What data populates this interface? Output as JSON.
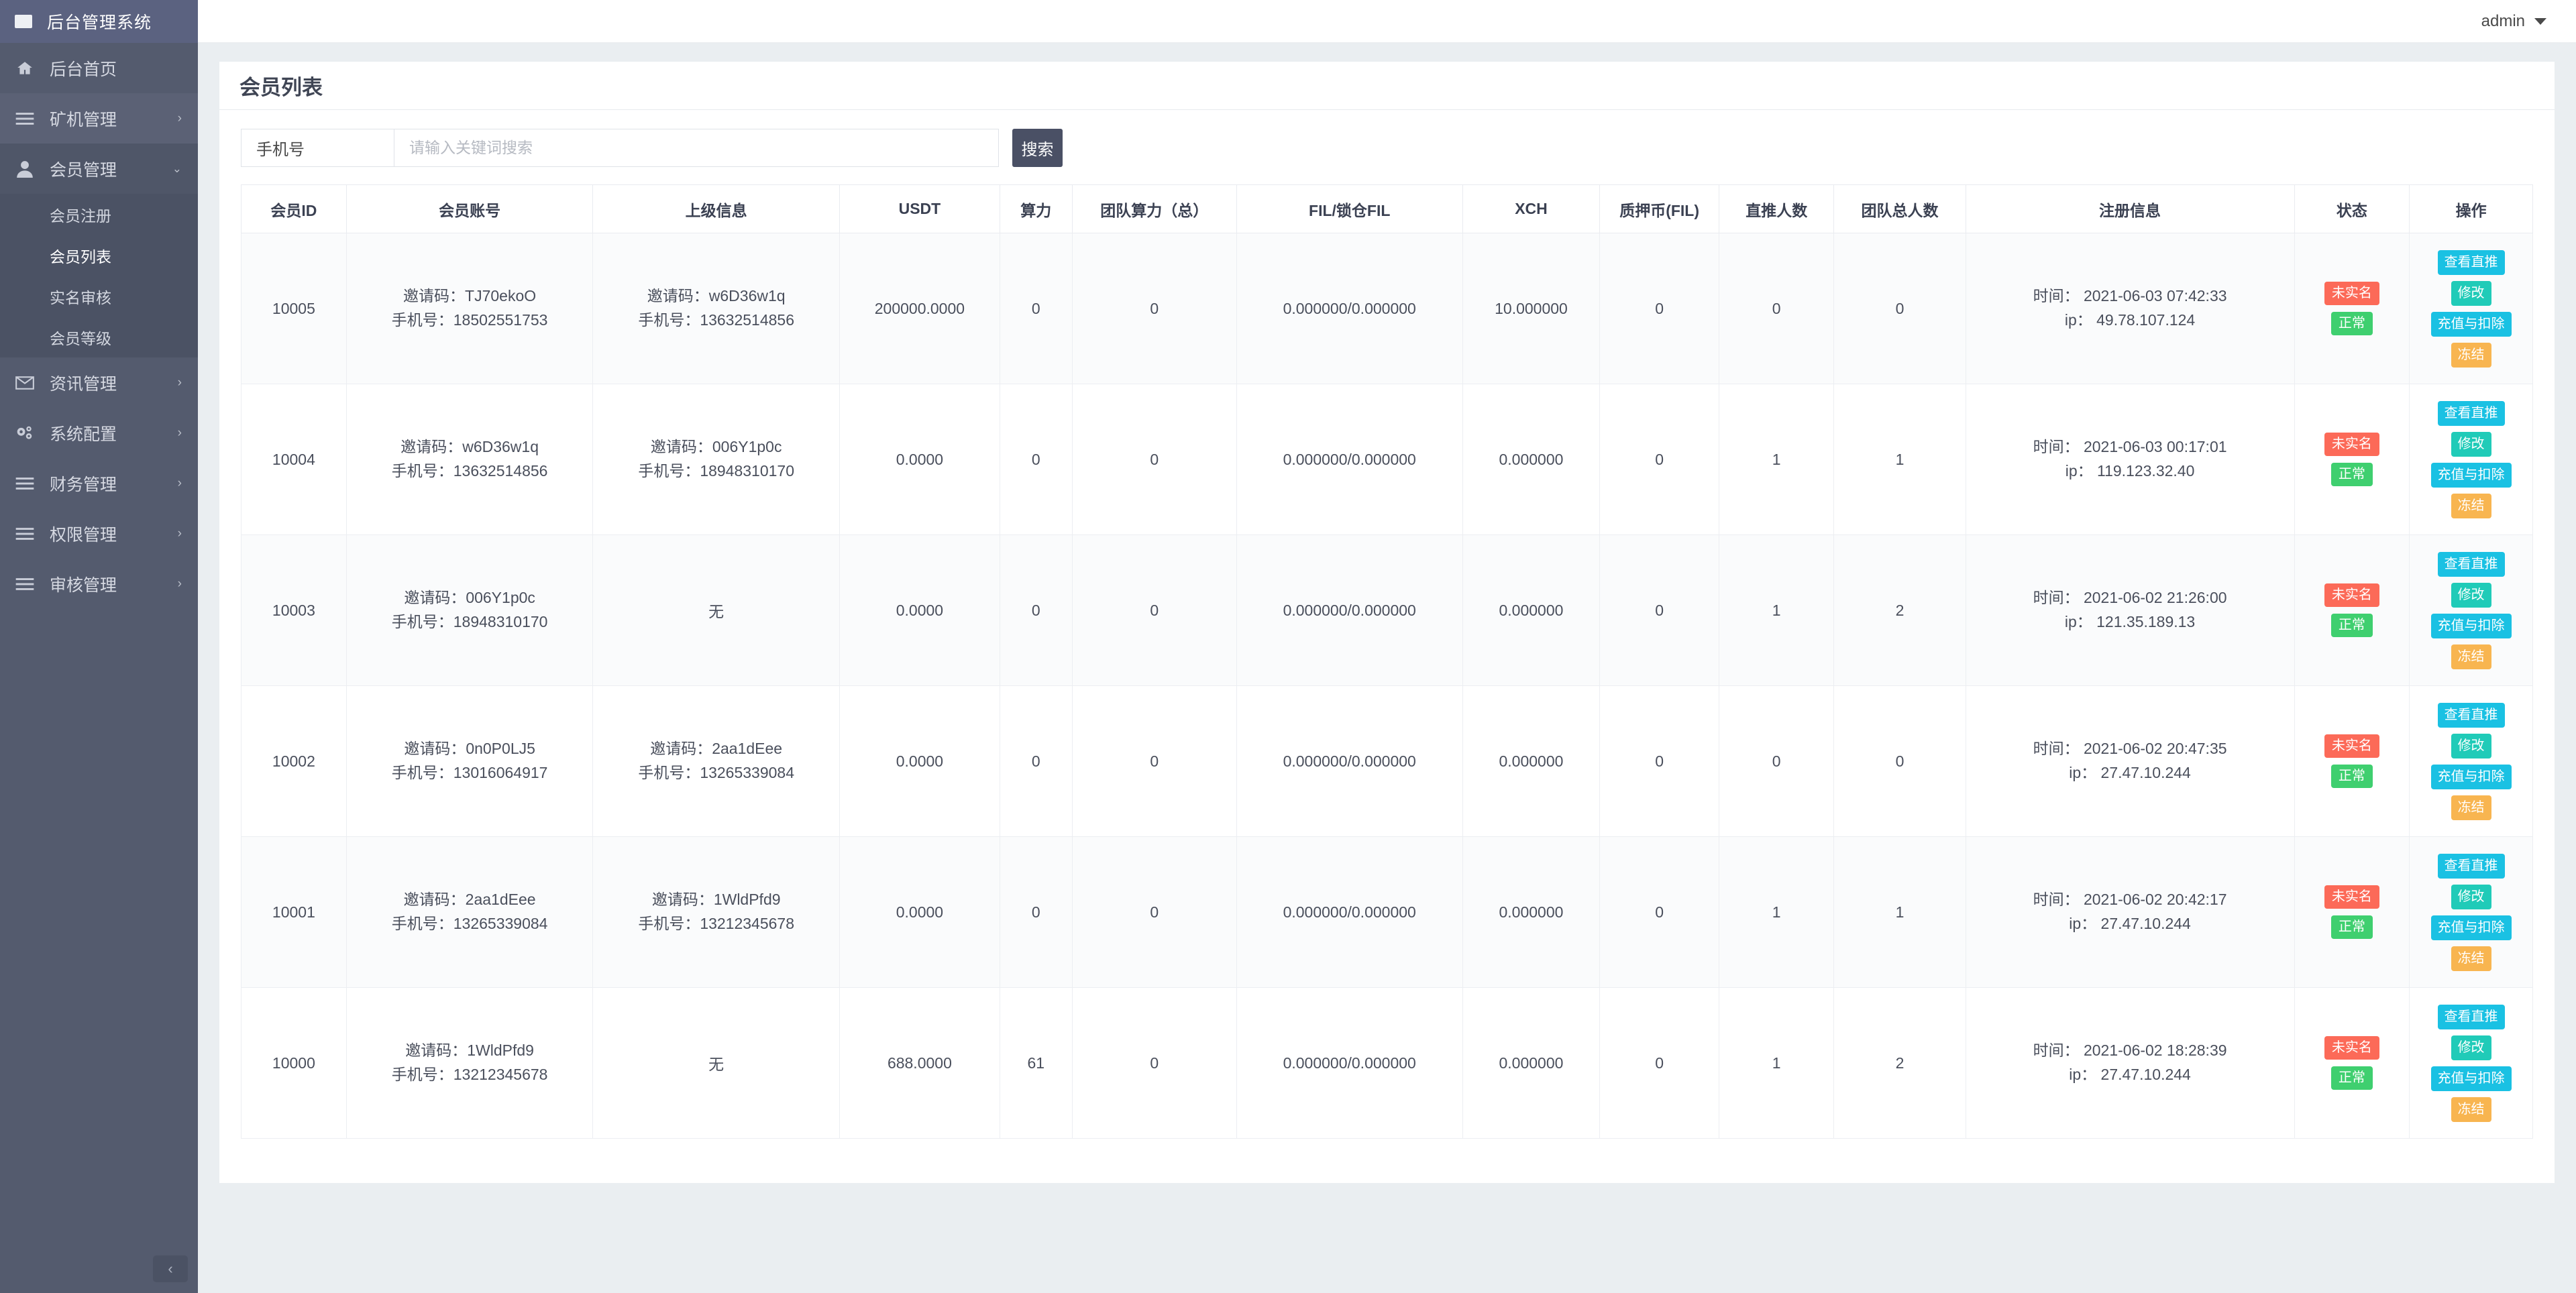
{
  "app": {
    "title": "后台管理系统",
    "logo_icon": "square-logo-icon"
  },
  "sidebar": {
    "items": [
      {
        "label": "后台首页",
        "icon": "home-icon",
        "arrow": "",
        "state": "plain"
      },
      {
        "label": "矿机管理",
        "icon": "list-icon",
        "arrow": "›",
        "state": "alt"
      },
      {
        "label": "会员管理",
        "icon": "user-icon",
        "arrow": "⌄",
        "state": "open"
      },
      {
        "label": "资讯管理",
        "icon": "envelope-icon",
        "arrow": "›",
        "state": "plain"
      },
      {
        "label": "系统配置",
        "icon": "gears-icon",
        "arrow": "›",
        "state": "plain"
      },
      {
        "label": "财务管理",
        "icon": "list-icon",
        "arrow": "›",
        "state": "plain"
      },
      {
        "label": "权限管理",
        "icon": "list-icon",
        "arrow": "›",
        "state": "plain"
      },
      {
        "label": "审核管理",
        "icon": "list-icon",
        "arrow": "›",
        "state": "plain"
      }
    ],
    "submenu": [
      {
        "label": "会员注册",
        "active": false
      },
      {
        "label": "会员列表",
        "active": true
      },
      {
        "label": "实名审核",
        "active": false
      },
      {
        "label": "会员等级",
        "active": false
      }
    ],
    "collapse_icon": "chevron-left-icon"
  },
  "topbar": {
    "admin_label": "admin",
    "caret_icon": "caret-down-icon"
  },
  "page": {
    "title": "会员列表"
  },
  "search": {
    "field_label": "手机号",
    "placeholder": "请输入关键词搜索",
    "value": "",
    "button_label": "搜索"
  },
  "table": {
    "headers": [
      "会员ID",
      "会员账号",
      "上级信息",
      "USDT",
      "算力",
      "团队算力（总）",
      "FIL/锁仓FIL",
      "XCH",
      "质押币(FIL)",
      "直推人数",
      "团队总人数",
      "注册信息",
      "状态",
      "操作"
    ],
    "labels": {
      "invite_code": "邀请码：",
      "phone": "手机号：",
      "time": "时间：",
      "ip": "ip：",
      "none": "无"
    },
    "rows": [
      {
        "id": "10005",
        "account_code": "TJ70ekoO",
        "account_phone": "18502551753",
        "parent_code": "w6D36w1q",
        "parent_phone": "13632514856",
        "parent_none": false,
        "usdt": "200000.0000",
        "power": "0",
        "team_power": "0",
        "fil": "0.000000/0.000000",
        "xch": "10.000000",
        "pledge": "0",
        "direct": "0",
        "team_total": "0",
        "reg_time": "2021-06-03 07:42:33",
        "reg_ip": "49.78.107.124"
      },
      {
        "id": "10004",
        "account_code": "w6D36w1q",
        "account_phone": "13632514856",
        "parent_code": "006Y1p0c",
        "parent_phone": "18948310170",
        "parent_none": false,
        "usdt": "0.0000",
        "power": "0",
        "team_power": "0",
        "fil": "0.000000/0.000000",
        "xch": "0.000000",
        "pledge": "0",
        "direct": "1",
        "team_total": "1",
        "reg_time": "2021-06-03 00:17:01",
        "reg_ip": "119.123.32.40"
      },
      {
        "id": "10003",
        "account_code": "006Y1p0c",
        "account_phone": "18948310170",
        "parent_code": "",
        "parent_phone": "",
        "parent_none": true,
        "usdt": "0.0000",
        "power": "0",
        "team_power": "0",
        "fil": "0.000000/0.000000",
        "xch": "0.000000",
        "pledge": "0",
        "direct": "1",
        "team_total": "2",
        "reg_time": "2021-06-02 21:26:00",
        "reg_ip": "121.35.189.13"
      },
      {
        "id": "10002",
        "account_code": "0n0P0LJ5",
        "account_phone": "13016064917",
        "parent_code": "2aa1dEee",
        "parent_phone": "13265339084",
        "parent_none": false,
        "usdt": "0.0000",
        "power": "0",
        "team_power": "0",
        "fil": "0.000000/0.000000",
        "xch": "0.000000",
        "pledge": "0",
        "direct": "0",
        "team_total": "0",
        "reg_time": "2021-06-02 20:47:35",
        "reg_ip": "27.47.10.244"
      },
      {
        "id": "10001",
        "account_code": "2aa1dEee",
        "account_phone": "13265339084",
        "parent_code": "1WldPfd9",
        "parent_phone": "13212345678",
        "parent_none": false,
        "usdt": "0.0000",
        "power": "0",
        "team_power": "0",
        "fil": "0.000000/0.000000",
        "xch": "0.000000",
        "pledge": "0",
        "direct": "1",
        "team_total": "1",
        "reg_time": "2021-06-02 20:42:17",
        "reg_ip": "27.47.10.244"
      },
      {
        "id": "10000",
        "account_code": "1WldPfd9",
        "account_phone": "13212345678",
        "parent_code": "",
        "parent_phone": "",
        "parent_none": true,
        "usdt": "688.0000",
        "power": "61",
        "team_power": "0",
        "fil": "0.000000/0.000000",
        "xch": "0.000000",
        "pledge": "0",
        "direct": "1",
        "team_total": "2",
        "reg_time": "2021-06-02 18:28:39",
        "reg_ip": "27.47.10.244"
      }
    ],
    "status_badges": [
      {
        "label": "未实名",
        "color": "#fc6a58",
        "cls": "red"
      },
      {
        "label": "正常",
        "color": "#3fcf6f",
        "cls": "green"
      }
    ],
    "operations": [
      {
        "label": "查看直推",
        "color": "#1ac1e3",
        "cls": "op-cyan",
        "name": "view-direct-button"
      },
      {
        "label": "修改",
        "color": "#20cbb8",
        "cls": "op-teal",
        "name": "edit-button"
      },
      {
        "label": "充值与扣除",
        "color": "#1ac1e3",
        "cls": "op-cyan",
        "name": "recharge-deduct-button"
      },
      {
        "label": "冻结",
        "color": "#f8b550",
        "cls": "op-orange",
        "name": "freeze-button"
      }
    ]
  },
  "colors": {
    "sidebar_bg": "#545b6e",
    "sidebar_logo_bg": "#5b6280",
    "submenu_bg": "#4b5264",
    "page_bg": "#eaeef1",
    "search_button": "#4a5065"
  }
}
